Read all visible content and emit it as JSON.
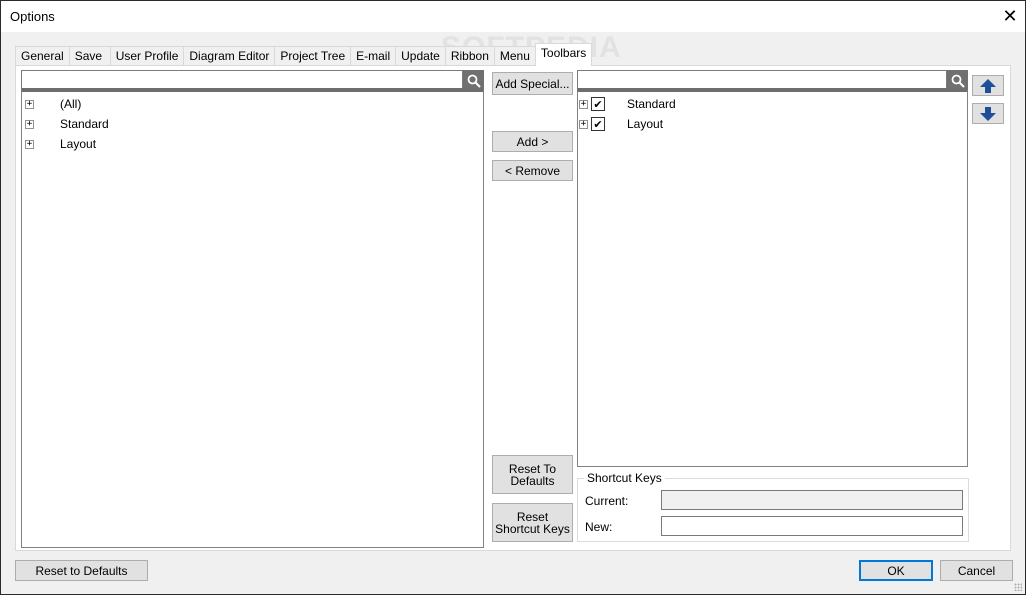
{
  "window": {
    "title": "Options",
    "close_label": "✕",
    "watermark": "SOFTPEDIA"
  },
  "tabs": [
    {
      "label": "General",
      "active": false
    },
    {
      "label": "Save",
      "active": false
    },
    {
      "label": "User Profile",
      "active": false
    },
    {
      "label": "Diagram Editor",
      "active": false
    },
    {
      "label": "Project Tree",
      "active": false
    },
    {
      "label": "E-mail",
      "active": false
    },
    {
      "label": "Update",
      "active": false
    },
    {
      "label": "Ribbon",
      "active": false
    },
    {
      "label": "Menu",
      "active": false
    },
    {
      "label": "Toolbars",
      "active": true
    }
  ],
  "left_panel": {
    "search_value": "",
    "search_icon": "search-icon",
    "items": [
      {
        "label": "(All)",
        "expander": "+"
      },
      {
        "label": "Standard",
        "expander": "+"
      },
      {
        "label": "Layout",
        "expander": "+"
      }
    ]
  },
  "middle_buttons": {
    "add_special": "Add Special...",
    "add": "Add >",
    "remove": "< Remove",
    "reset_to_defaults_line1": "Reset To",
    "reset_to_defaults_line2": "Defaults",
    "reset_shortcut_line1": "Reset",
    "reset_shortcut_line2": "Shortcut Keys"
  },
  "right_panel": {
    "search_value": "",
    "search_icon": "search-icon",
    "items": [
      {
        "label": "Standard",
        "expander": "+",
        "checked": true,
        "check_glyph": "✔"
      },
      {
        "label": "Layout",
        "expander": "+",
        "checked": true,
        "check_glyph": "✔"
      }
    ],
    "move_up_icon": "arrow-up-icon",
    "move_down_icon": "arrow-down-icon"
  },
  "shortcut_keys": {
    "group_label": "Shortcut Keys",
    "current_label": "Current:",
    "current_value": "",
    "new_label": "New:",
    "new_value": ""
  },
  "footer": {
    "reset_to_defaults": "Reset to Defaults",
    "ok": "OK",
    "cancel": "Cancel"
  },
  "colors": {
    "accent_blue": "#0078d7",
    "arrow_blue": "#1f4e9a"
  }
}
